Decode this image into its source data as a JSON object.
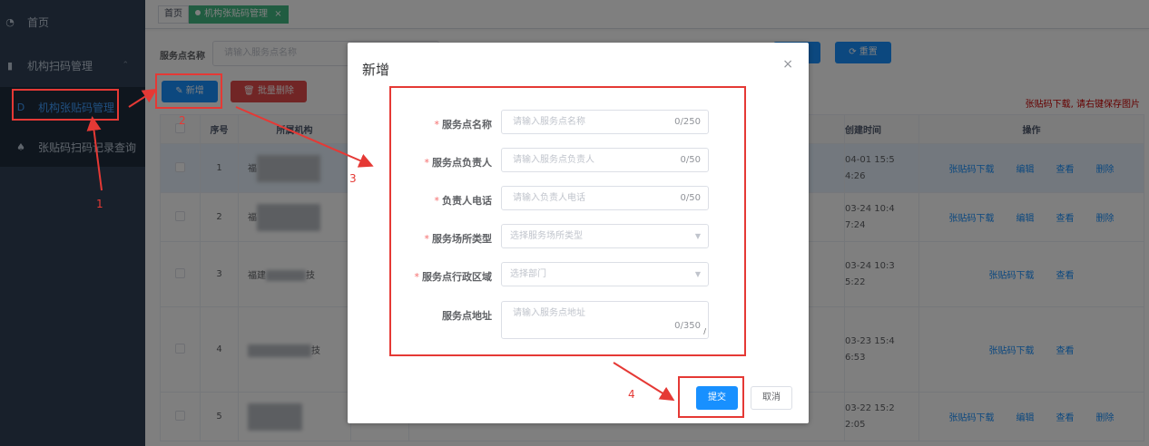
{
  "sidebar": {
    "items": [
      {
        "label": "首页",
        "icon": "dashboard-icon"
      },
      {
        "label": "机构扫码管理",
        "icon": "chart-bar-icon"
      },
      {
        "label": "机构张贴码管理",
        "icon": "doc-icon"
      },
      {
        "label": "张贴码扫码记录查询",
        "icon": "paw-icon"
      }
    ]
  },
  "tags": {
    "home": "首页",
    "current": "机构张贴码管理",
    "close": "×"
  },
  "search": {
    "label": "服务点名称",
    "placeholder": "请输入服务点名称",
    "search_btn": "搜索",
    "search_partial": "索",
    "reset_btn": "重置"
  },
  "toolbar": {
    "add": "新增",
    "batch_delete": "批量删除",
    "hint": "张贴码下载, 请右键保存图片"
  },
  "table": {
    "headers": {
      "seq": "序号",
      "org": "所属机构",
      "created": "创建时间",
      "ops": "操作"
    },
    "rows": [
      {
        "seq": "1",
        "org": "福",
        "time1": "04-01 15:5",
        "time2": "4:26",
        "ops": [
          "张贴码下载",
          "编辑",
          "查看",
          "删除"
        ]
      },
      {
        "seq": "2",
        "org": "福",
        "time1": "03-24 10:4",
        "time2": "7:24",
        "ops": [
          "张贴码下载",
          "编辑",
          "查看",
          "删除"
        ]
      },
      {
        "seq": "3",
        "org": "福建",
        "org_suffix": "技",
        "time1": "03-24 10:3",
        "time2": "5:22",
        "ops": [
          "张贴码下载",
          "查看"
        ]
      },
      {
        "seq": "4",
        "org": "",
        "org_suffix": "技",
        "time1": "03-23 15:4",
        "time2": "6:53",
        "ops": [
          "张贴码下载",
          "查看"
        ]
      },
      {
        "seq": "5",
        "org": "",
        "time1": "03-22 15:2",
        "time2": "2:05",
        "ops": [
          "张贴码下载",
          "编辑",
          "查看",
          "删除"
        ]
      }
    ]
  },
  "dialog": {
    "title": "新增",
    "close": "×",
    "fields": [
      {
        "label": "服务点名称",
        "required": true,
        "placeholder": "请输入服务点名称",
        "count": "0/250",
        "kind": "text"
      },
      {
        "label": "服务点负责人",
        "required": true,
        "placeholder": "请输入服务点负责人",
        "count": "0/50",
        "kind": "text"
      },
      {
        "label": "负责人电话",
        "required": true,
        "placeholder": "请输入负责人电话",
        "count": "0/50",
        "kind": "text"
      },
      {
        "label": "服务场所类型",
        "required": true,
        "placeholder": "选择服务场所类型",
        "kind": "select"
      },
      {
        "label": "服务点行政区域",
        "required": true,
        "placeholder": "选择部门",
        "kind": "select"
      },
      {
        "label": "服务点地址",
        "required": false,
        "placeholder": "请输入服务点地址",
        "count": "0/350",
        "kind": "textarea"
      }
    ],
    "submit": "提交",
    "cancel": "取消"
  },
  "annotations": {
    "n1": "1",
    "n2": "2",
    "n3": "3",
    "n4": "4"
  },
  "colors": {
    "sidebar": "#304156",
    "primary": "#1890ff",
    "danger": "#e24b4b",
    "tag_active": "#42b983",
    "annotation": "#e53935"
  }
}
